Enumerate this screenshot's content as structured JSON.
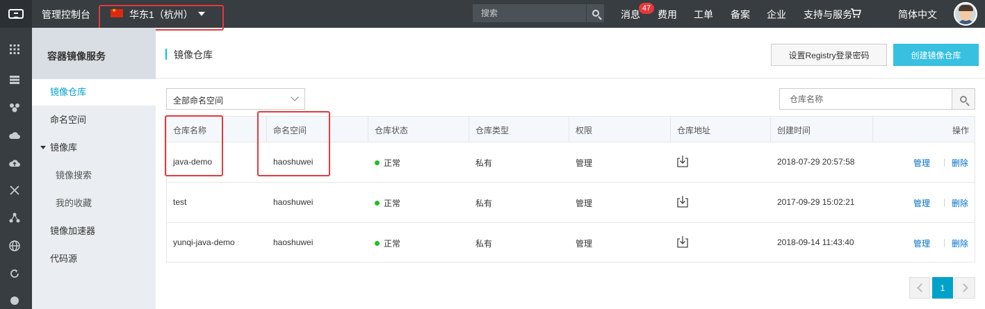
{
  "topbar": {
    "console_title": "管理控制台",
    "region": "华东1（杭州）",
    "search_placeholder": "搜索",
    "nav": {
      "messages": "消息",
      "messages_badge": "47",
      "billing": "费用",
      "tickets": "工单",
      "icp": "备案",
      "enterprise": "企业",
      "support": "支持与服务",
      "language": "简体中文"
    }
  },
  "sidebar": {
    "title": "容器镜像服务",
    "items": [
      {
        "label": "镜像仓库"
      },
      {
        "label": "命名空间"
      },
      {
        "label": "镜像库"
      },
      {
        "label": "镜像搜索"
      },
      {
        "label": "我的收藏"
      },
      {
        "label": "镜像加速器"
      },
      {
        "label": "代码源"
      }
    ]
  },
  "main": {
    "title": "镜像仓库",
    "set_registry_password": "设置Registry登录密码",
    "create_repo": "创建镜像仓库",
    "namespace_select": "全部命名空间",
    "repo_search_placeholder": "仓库名称"
  },
  "table": {
    "columns": [
      "仓库名称",
      "命名空间",
      "仓库状态",
      "仓库类型",
      "权限",
      "仓库地址",
      "创建时间",
      "操作"
    ],
    "rows": [
      {
        "name": "java-demo",
        "namespace": "haoshuwei",
        "status": "正常",
        "type": "私有",
        "permission": "管理",
        "created": "2018-07-29 20:57:58",
        "op_manage": "管理",
        "op_delete": "删除"
      },
      {
        "name": "test",
        "namespace": "haoshuwei",
        "status": "正常",
        "type": "私有",
        "permission": "管理",
        "created": "2017-09-29 15:02:21",
        "op_manage": "管理",
        "op_delete": "删除"
      },
      {
        "name": "yunqi-java-demo",
        "namespace": "haoshuwei",
        "status": "正常",
        "type": "私有",
        "permission": "管理",
        "created": "2018-09-14 11:43:40",
        "op_manage": "管理",
        "op_delete": "删除"
      }
    ],
    "op_separator": "|"
  },
  "pagination": {
    "current": "1"
  },
  "colors": {
    "accent": "#00c1de",
    "primary_button": "#37c0e0",
    "link": "#0070cc",
    "highlight": "#e4393c",
    "status_ok": "#1dc11d"
  }
}
